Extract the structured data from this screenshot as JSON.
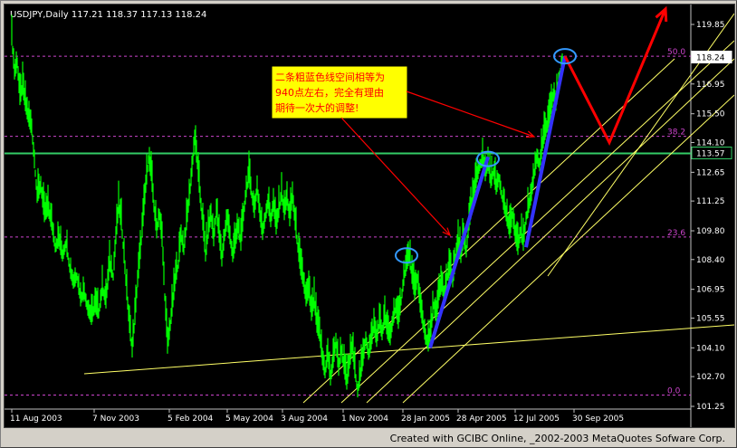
{
  "window": {
    "header": "USDJPY,Daily  117.21 118.37 117.13 118.24",
    "footer": "Created with GCIBC Online, _2002-2003 MetaQuotes Sofware Corp."
  },
  "annotation": {
    "lines": [
      "二条粗蓝色线空间相等为",
      "940点左右，完全有理由",
      "期待一次大的调整!"
    ]
  },
  "colors": {
    "background": "#000000",
    "candles": "#00ff00",
    "blue_wave": "#3333ff",
    "red_forecast": "#ff0000",
    "channel": "#ffff66",
    "fib_levels": "#cc44cc",
    "price_line": "#33cc66",
    "marker_circle": "#3399ff",
    "annotation_bg": "#ffff00",
    "annotation_text": "#ff0000"
  },
  "chart_data": {
    "type": "line",
    "title": "USDJPY,Daily",
    "ohlc_header": {
      "open": 117.21,
      "high": 118.37,
      "low": 117.13,
      "close": 118.24
    },
    "x_ticks": [
      "11 Aug 2003",
      "7 Nov 2003",
      "5 Feb 2004",
      "5 May 2004",
      "3 Aug 2004",
      "1 Nov 2004",
      "28 Jan 2005",
      "28 Apr 2005",
      "12 Jul 2005",
      "30 Sep 2005"
    ],
    "y_ticks": [
      119.85,
      118.4,
      116.95,
      115.5,
      114.1,
      112.65,
      111.25,
      109.8,
      108.4,
      106.95,
      105.55,
      104.1,
      102.7,
      101.25
    ],
    "ylim": [
      101.25,
      119.85
    ],
    "price_labels": [
      {
        "value": 118.24,
        "label": "118.24"
      },
      {
        "value": 113.57,
        "label": "113.57"
      }
    ],
    "fib_levels": [
      {
        "label": "50.0",
        "value": 118.3
      },
      {
        "label": "38.2",
        "value": 114.4
      },
      {
        "label": "23.6",
        "value": 109.5
      },
      {
        "label": "0.0",
        "value": 101.8
      }
    ],
    "series": [
      {
        "name": "",
        "values": [
          {
            "x": 0,
            "y": 119.2
          },
          {
            "x": 3,
            "y": 117.5
          },
          {
            "x": 6,
            "y": 118.0
          },
          {
            "x": 9,
            "y": 116.3
          },
          {
            "x": 12,
            "y": 116.8
          },
          {
            "x": 15,
            "y": 116.0
          },
          {
            "x": 18,
            "y": 115.4
          },
          {
            "x": 22,
            "y": 114.8
          },
          {
            "x": 25,
            "y": 113.2
          },
          {
            "x": 28,
            "y": 111.5
          },
          {
            "x": 32,
            "y": 112.0
          },
          {
            "x": 36,
            "y": 110.6
          },
          {
            "x": 40,
            "y": 110.9
          },
          {
            "x": 44,
            "y": 110.2
          },
          {
            "x": 48,
            "y": 109.0
          },
          {
            "x": 52,
            "y": 109.4
          },
          {
            "x": 56,
            "y": 108.6
          },
          {
            "x": 60,
            "y": 109.2
          },
          {
            "x": 64,
            "y": 108.0
          },
          {
            "x": 68,
            "y": 107.3
          },
          {
            "x": 72,
            "y": 107.6
          },
          {
            "x": 76,
            "y": 106.5
          },
          {
            "x": 80,
            "y": 106.8
          },
          {
            "x": 84,
            "y": 106.0
          },
          {
            "x": 88,
            "y": 105.6
          },
          {
            "x": 92,
            "y": 106.2
          },
          {
            "x": 96,
            "y": 105.8
          },
          {
            "x": 100,
            "y": 107.0
          },
          {
            "x": 104,
            "y": 106.4
          },
          {
            "x": 108,
            "y": 108.2
          },
          {
            "x": 112,
            "y": 107.6
          },
          {
            "x": 115,
            "y": 109.5
          },
          {
            "x": 118,
            "y": 111.0
          },
          {
            "x": 121,
            "y": 110.2
          },
          {
            "x": 124,
            "y": 108.6
          },
          {
            "x": 127,
            "y": 106.8
          },
          {
            "x": 130,
            "y": 105.2
          },
          {
            "x": 133,
            "y": 104.0
          },
          {
            "x": 136,
            "y": 105.6
          },
          {
            "x": 139,
            "y": 107.4
          },
          {
            "x": 142,
            "y": 108.8
          },
          {
            "x": 145,
            "y": 110.4
          },
          {
            "x": 148,
            "y": 112.0
          },
          {
            "x": 151,
            "y": 113.3
          },
          {
            "x": 154,
            "y": 112.6
          },
          {
            "x": 157,
            "y": 111.0
          },
          {
            "x": 160,
            "y": 109.8
          },
          {
            "x": 163,
            "y": 110.6
          },
          {
            "x": 166,
            "y": 109.4
          },
          {
            "x": 169,
            "y": 106.6
          },
          {
            "x": 172,
            "y": 104.2
          },
          {
            "x": 175,
            "y": 105.2
          },
          {
            "x": 178,
            "y": 106.4
          },
          {
            "x": 181,
            "y": 107.6
          },
          {
            "x": 184,
            "y": 108.2
          },
          {
            "x": 187,
            "y": 109.6
          },
          {
            "x": 190,
            "y": 108.9
          },
          {
            "x": 193,
            "y": 110.2
          },
          {
            "x": 196,
            "y": 111.4
          },
          {
            "x": 199,
            "y": 112.8
          },
          {
            "x": 202,
            "y": 114.3
          },
          {
            "x": 205,
            "y": 113.1
          },
          {
            "x": 208,
            "y": 111.5
          },
          {
            "x": 211,
            "y": 110.2
          },
          {
            "x": 214,
            "y": 108.6
          },
          {
            "x": 217,
            "y": 109.8
          },
          {
            "x": 220,
            "y": 110.6
          },
          {
            "x": 223,
            "y": 109.4
          },
          {
            "x": 226,
            "y": 110.8
          },
          {
            "x": 229,
            "y": 109.6
          },
          {
            "x": 232,
            "y": 108.4
          },
          {
            "x": 235,
            "y": 109.6
          },
          {
            "x": 238,
            "y": 110.4
          },
          {
            "x": 241,
            "y": 109.5
          },
          {
            "x": 244,
            "y": 108.6
          },
          {
            "x": 247,
            "y": 109.3
          },
          {
            "x": 250,
            "y": 110.0
          },
          {
            "x": 253,
            "y": 109.2
          },
          {
            "x": 256,
            "y": 110.6
          },
          {
            "x": 259,
            "y": 111.8
          },
          {
            "x": 262,
            "y": 112.5
          },
          {
            "x": 265,
            "y": 111.6
          },
          {
            "x": 268,
            "y": 110.8
          },
          {
            "x": 271,
            "y": 111.9
          },
          {
            "x": 274,
            "y": 110.6
          },
          {
            "x": 277,
            "y": 109.7
          },
          {
            "x": 280,
            "y": 110.5
          },
          {
            "x": 283,
            "y": 111.2
          },
          {
            "x": 286,
            "y": 110.3
          },
          {
            "x": 289,
            "y": 111.1
          },
          {
            "x": 292,
            "y": 110.0
          },
          {
            "x": 295,
            "y": 110.8
          },
          {
            "x": 298,
            "y": 111.6
          },
          {
            "x": 301,
            "y": 110.7
          },
          {
            "x": 304,
            "y": 111.4
          },
          {
            "x": 307,
            "y": 110.4
          },
          {
            "x": 310,
            "y": 111.5
          },
          {
            "x": 313,
            "y": 110.2
          },
          {
            "x": 316,
            "y": 109.0
          },
          {
            "x": 319,
            "y": 108.0
          },
          {
            "x": 322,
            "y": 107.4
          },
          {
            "x": 325,
            "y": 106.5
          },
          {
            "x": 328,
            "y": 106.9
          },
          {
            "x": 331,
            "y": 105.8
          },
          {
            "x": 334,
            "y": 106.4
          },
          {
            "x": 337,
            "y": 105.2
          },
          {
            "x": 340,
            "y": 104.8
          },
          {
            "x": 343,
            "y": 103.6
          },
          {
            "x": 346,
            "y": 102.9
          },
          {
            "x": 349,
            "y": 103.8
          },
          {
            "x": 352,
            "y": 102.6
          },
          {
            "x": 355,
            "y": 103.5
          },
          {
            "x": 358,
            "y": 104.4
          },
          {
            "x": 361,
            "y": 103.1
          },
          {
            "x": 364,
            "y": 104.0
          },
          {
            "x": 367,
            "y": 103.2
          },
          {
            "x": 370,
            "y": 102.4
          },
          {
            "x": 373,
            "y": 103.4
          },
          {
            "x": 376,
            "y": 104.2
          },
          {
            "x": 379,
            "y": 103.0
          },
          {
            "x": 382,
            "y": 102.0
          },
          {
            "x": 385,
            "y": 102.8
          },
          {
            "x": 388,
            "y": 103.6
          },
          {
            "x": 391,
            "y": 104.6
          },
          {
            "x": 394,
            "y": 103.8
          },
          {
            "x": 397,
            "y": 104.4
          },
          {
            "x": 400,
            "y": 105.2
          },
          {
            "x": 403,
            "y": 104.5
          },
          {
            "x": 406,
            "y": 105.4
          },
          {
            "x": 409,
            "y": 104.8
          },
          {
            "x": 412,
            "y": 105.6
          },
          {
            "x": 415,
            "y": 104.9
          },
          {
            "x": 418,
            "y": 104.6
          },
          {
            "x": 421,
            "y": 105.5
          },
          {
            "x": 424,
            "y": 106.1
          },
          {
            "x": 427,
            "y": 105.4
          },
          {
            "x": 430,
            "y": 106.4
          },
          {
            "x": 433,
            "y": 107.5
          },
          {
            "x": 436,
            "y": 108.2
          },
          {
            "x": 439,
            "y": 108.6
          },
          {
            "x": 442,
            "y": 107.6
          },
          {
            "x": 445,
            "y": 106.8
          },
          {
            "x": 448,
            "y": 107.5
          },
          {
            "x": 451,
            "y": 106.2
          },
          {
            "x": 454,
            "y": 105.4
          },
          {
            "x": 457,
            "y": 104.6
          },
          {
            "x": 460,
            "y": 104.3
          },
          {
            "x": 463,
            "y": 105.0
          },
          {
            "x": 466,
            "y": 106.2
          },
          {
            "x": 469,
            "y": 105.6
          },
          {
            "x": 472,
            "y": 106.8
          },
          {
            "x": 475,
            "y": 107.2
          },
          {
            "x": 478,
            "y": 106.6
          },
          {
            "x": 481,
            "y": 107.6
          },
          {
            "x": 484,
            "y": 108.0
          },
          {
            "x": 487,
            "y": 107.4
          },
          {
            "x": 490,
            "y": 108.4
          },
          {
            "x": 493,
            "y": 109.2
          },
          {
            "x": 496,
            "y": 108.6
          },
          {
            "x": 499,
            "y": 109.5
          },
          {
            "x": 502,
            "y": 108.8
          },
          {
            "x": 505,
            "y": 110.2
          },
          {
            "x": 508,
            "y": 111.0
          },
          {
            "x": 511,
            "y": 111.8
          },
          {
            "x": 514,
            "y": 112.5
          },
          {
            "x": 517,
            "y": 113.0
          },
          {
            "x": 520,
            "y": 113.3
          },
          {
            "x": 523,
            "y": 112.6
          },
          {
            "x": 526,
            "y": 113.1
          },
          {
            "x": 529,
            "y": 112.2
          },
          {
            "x": 532,
            "y": 112.7
          },
          {
            "x": 535,
            "y": 111.9
          },
          {
            "x": 538,
            "y": 112.4
          },
          {
            "x": 541,
            "y": 111.6
          },
          {
            "x": 544,
            "y": 111.0
          },
          {
            "x": 547,
            "y": 110.4
          },
          {
            "x": 550,
            "y": 109.8
          },
          {
            "x": 553,
            "y": 110.6
          },
          {
            "x": 556,
            "y": 109.6
          },
          {
            "x": 559,
            "y": 109.0
          },
          {
            "x": 562,
            "y": 109.8
          },
          {
            "x": 565,
            "y": 109.2
          },
          {
            "x": 568,
            "y": 110.4
          },
          {
            "x": 571,
            "y": 111.0
          },
          {
            "x": 574,
            "y": 111.6
          },
          {
            "x": 577,
            "y": 112.6
          },
          {
            "x": 580,
            "y": 113.4
          },
          {
            "x": 583,
            "y": 113.0
          },
          {
            "x": 586,
            "y": 114.0
          },
          {
            "x": 589,
            "y": 114.6
          },
          {
            "x": 592,
            "y": 115.0
          },
          {
            "x": 595,
            "y": 115.6
          },
          {
            "x": 598,
            "y": 116.4
          },
          {
            "x": 601,
            "y": 116.0
          },
          {
            "x": 604,
            "y": 117.0
          },
          {
            "x": 607,
            "y": 117.6
          },
          {
            "x": 610,
            "y": 118.2
          }
        ]
      }
    ],
    "blue_wave": [
      {
        "x": 462,
        "y": 104.1
      },
      {
        "x": 526,
        "y": 113.4
      },
      {
        "x": 568,
        "y": 109.0
      },
      {
        "x": 611,
        "y": 118.3
      }
    ],
    "red_forecast": [
      {
        "x": 611,
        "y": 118.3
      },
      {
        "x": 660,
        "y": 114.1
      },
      {
        "x": 722,
        "y": 120.6
      }
    ]
  }
}
